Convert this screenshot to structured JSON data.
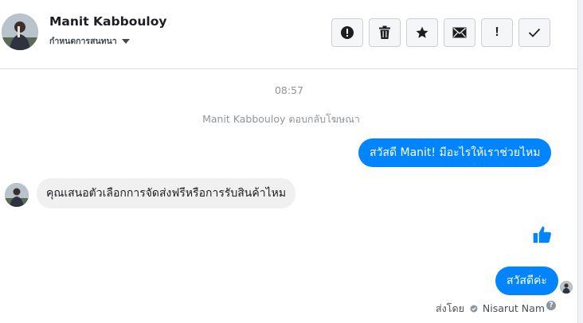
{
  "header": {
    "contact_name": "Manit Kabbouloy",
    "subtitle": "กำหนดการสนทนา",
    "toolbar": [
      {
        "name": "spam-button",
        "icon": "alert-circle-icon"
      },
      {
        "name": "delete-button",
        "icon": "trash-icon"
      },
      {
        "name": "star-button",
        "icon": "star-icon"
      },
      {
        "name": "mark-unread-button",
        "icon": "envelope-icon"
      },
      {
        "name": "priority-button",
        "icon": "exclamation-icon",
        "text": "!"
      },
      {
        "name": "done-button",
        "icon": "checkmark-icon"
      }
    ]
  },
  "conversation": {
    "timestamp": "08:57",
    "system_message": "Manit Kabbouloy ตอบกลับโฆษณา",
    "messages": [
      {
        "direction": "outgoing",
        "text": "สวัสดี Manit! มีอะไรให้เราช่วยไหม"
      },
      {
        "direction": "incoming",
        "text": "คุณเสนอตัวเลือกการจัดส่งฟรีหรือการรับสินค้าไหม"
      },
      {
        "direction": "outgoing",
        "type": "like",
        "icon": "thumbs-up-icon"
      },
      {
        "direction": "outgoing",
        "text": "สวัสดีค่ะ"
      }
    ],
    "sent_by_label": "ส่งโดย",
    "sent_by_name": "Nisarut Nam",
    "help_glyph": "?"
  },
  "colors": {
    "brand_blue": "#0084ff",
    "incoming_bubble": "#f1f0f0",
    "muted_text": "#90949c"
  }
}
